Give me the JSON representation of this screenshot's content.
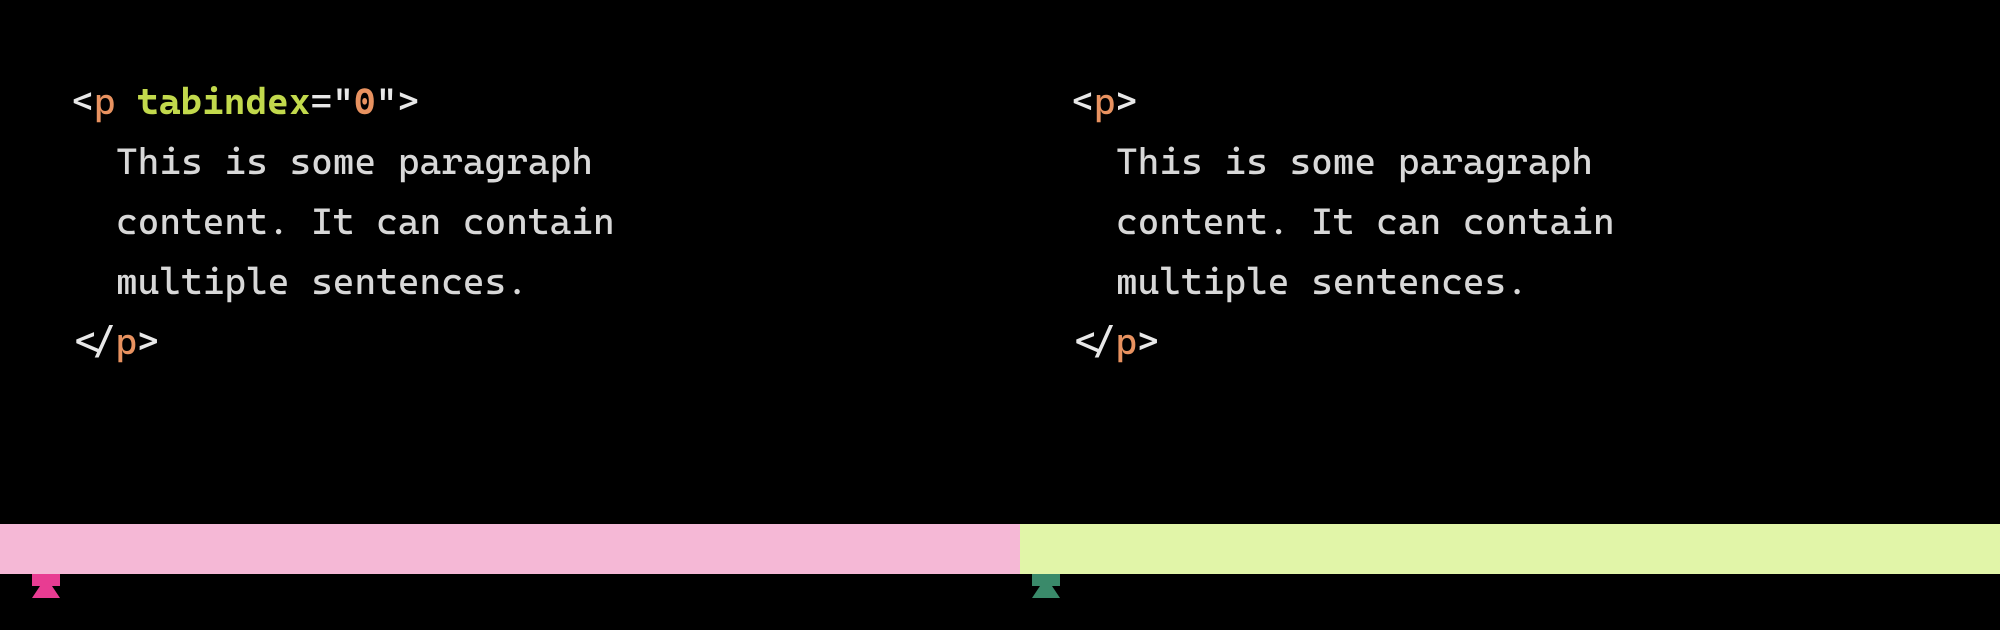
{
  "code_samples": {
    "left": {
      "open_bracket": "<",
      "tag_name": "p",
      "space": " ",
      "attr_name": "tabindex",
      "attr_equals": "=",
      "attr_quote": "\"",
      "attr_value": "0",
      "close_bracket": ">",
      "content_line1": "This is some paragraph",
      "content_line2": "content. It can contain",
      "content_line3": "multiple sentences.",
      "close_open_bracket": "</",
      "close_tag_name": "p",
      "final_bracket": ">"
    },
    "right": {
      "open_bracket": "<",
      "tag_name": "p",
      "close_bracket": ">",
      "content_line1": "This is some paragraph",
      "content_line2": "content. It can contain",
      "content_line3": "multiple sentences.",
      "close_open_bracket": "</",
      "close_tag_name": "p",
      "final_bracket": ">"
    }
  },
  "colors": {
    "stripe_left": "#f5b8d6",
    "stripe_right": "#e1f5a8",
    "icon_left": "#e83c92",
    "icon_right": "#3a8a6a"
  }
}
